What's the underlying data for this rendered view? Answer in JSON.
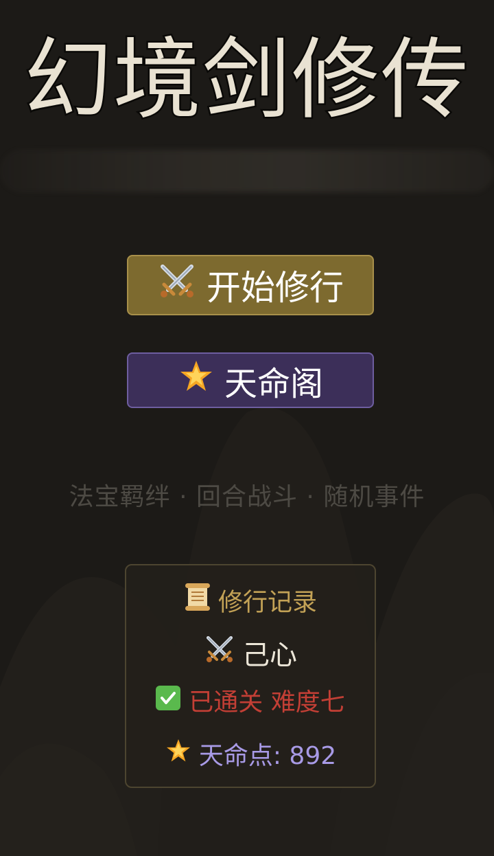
{
  "title": "幻境剑修传",
  "menu": {
    "start_icon": "crossed-swords-icon",
    "start_label": "开始修行",
    "fate_icon": "glowing-star-icon",
    "fate_label": "天命阁"
  },
  "subtitle": "法宝羁绊 · 回合战斗 · 随机事件",
  "record": {
    "title_icon": "scroll-icon",
    "title": "修行记录",
    "name_icon": "crossed-swords-icon",
    "name": "己心",
    "status_icon": "check-mark-icon",
    "status": "已通关 难度七",
    "points_icon": "glowing-star-icon",
    "points_label": "天命点: 892"
  },
  "colors": {
    "background": "#1c1a17",
    "title": "#e9e2d2",
    "start_button": "#7d6a2f",
    "fate_button": "#3c2f59",
    "record_title": "#c3a256",
    "status": "#c33f35",
    "points": "#a89ae6"
  }
}
